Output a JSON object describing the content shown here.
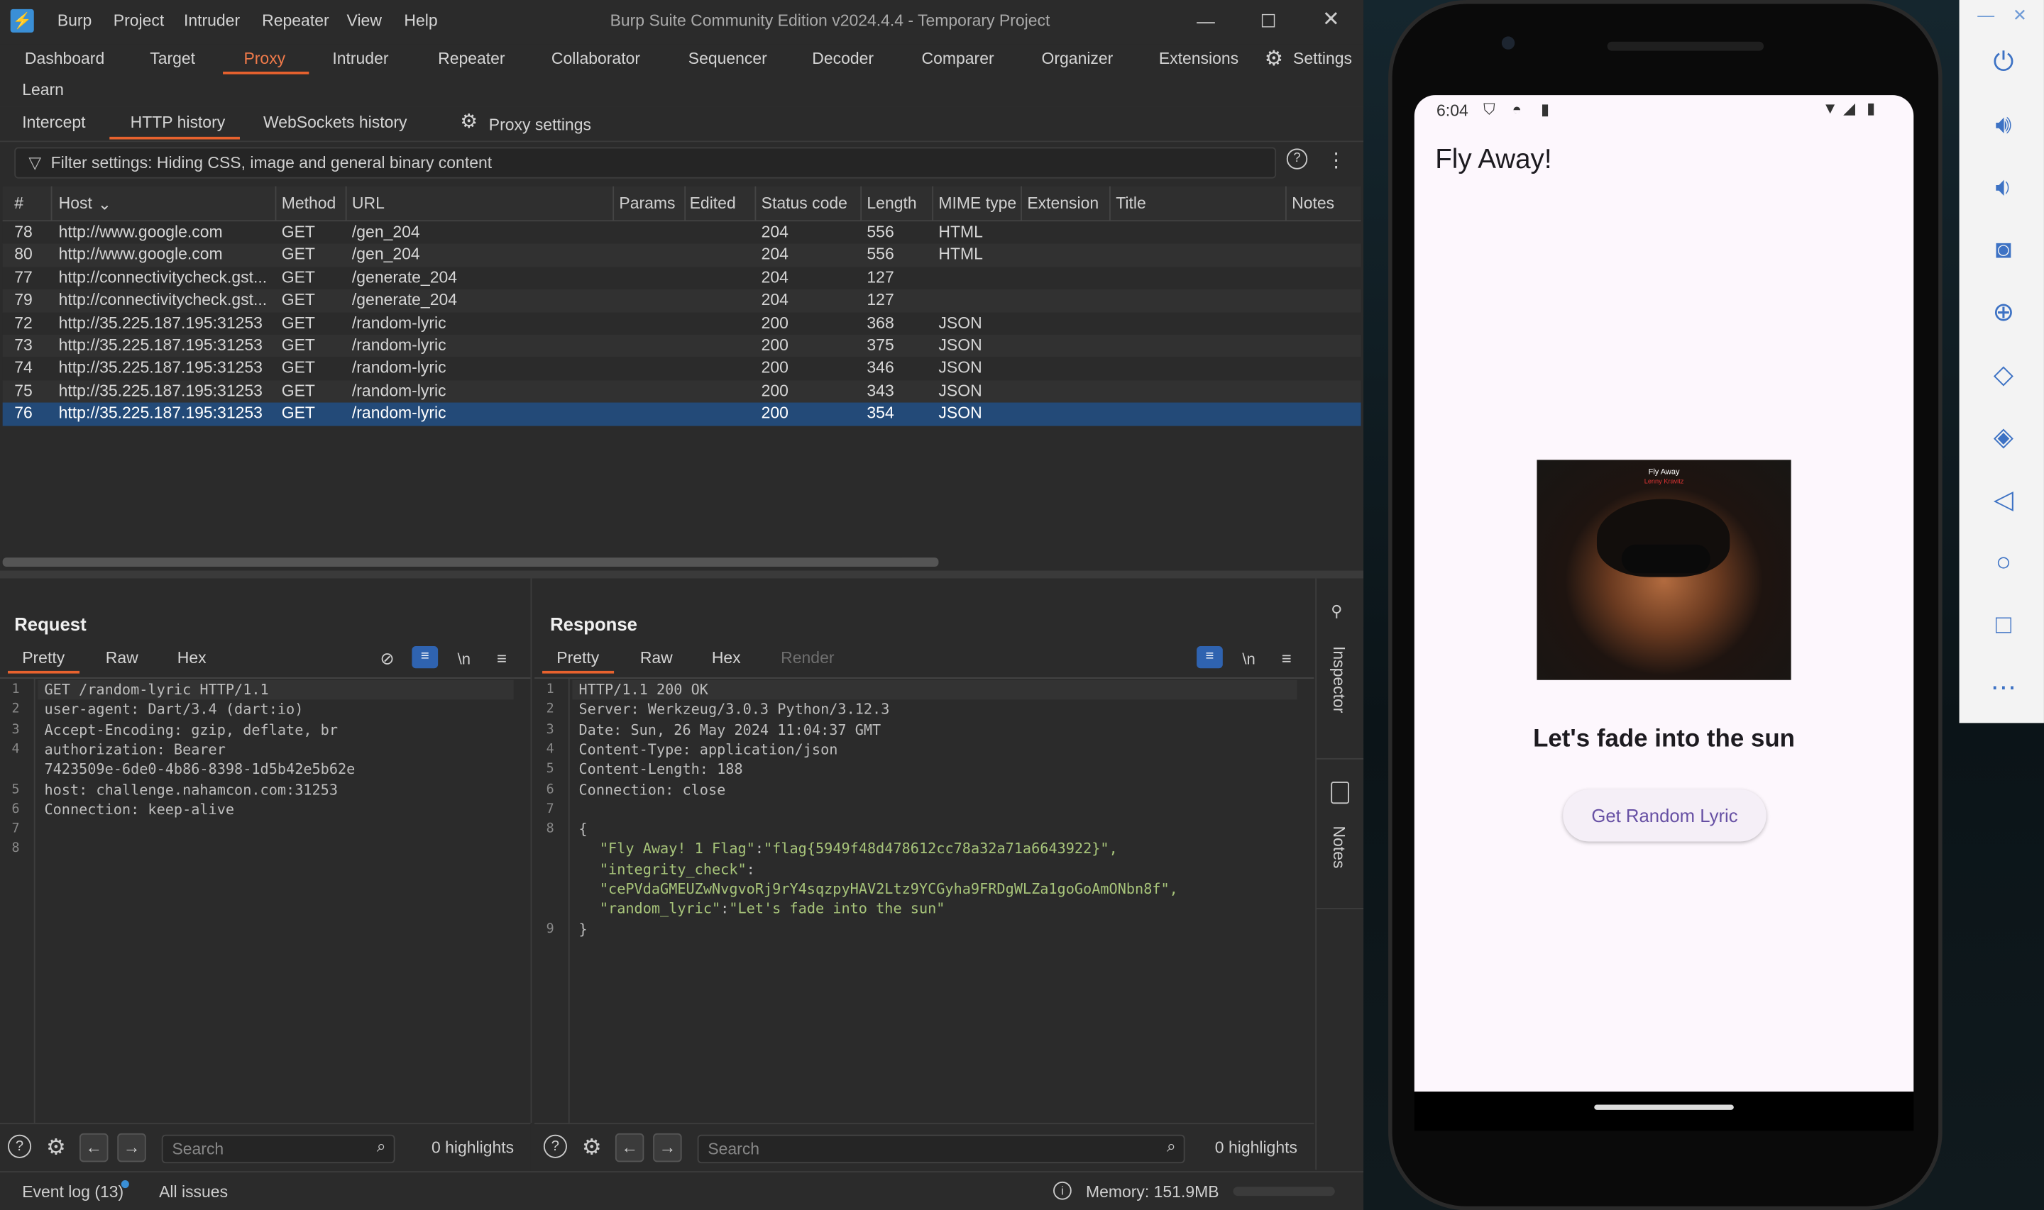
{
  "burp": {
    "menu": [
      "Burp",
      "Project",
      "Intruder",
      "Repeater",
      "View",
      "Help"
    ],
    "window_title": "Burp Suite Community Edition v2024.4.4 - Temporary Project",
    "main_tabs": [
      "Dashboard",
      "Target",
      "Proxy",
      "Intruder",
      "Repeater",
      "Collaborator",
      "Sequencer",
      "Decoder",
      "Comparer",
      "Organizer",
      "Extensions"
    ],
    "settings_label": "Settings",
    "learn_label": "Learn",
    "active_main_tab": "Proxy",
    "sub_tabs": [
      "Intercept",
      "HTTP history",
      "WebSockets history"
    ],
    "active_sub_tab": "HTTP history",
    "proxy_settings_label": "Proxy settings",
    "filter_text": "Filter settings: Hiding CSS, image and general binary content",
    "columns": [
      "#",
      "Host",
      "Method",
      "URL",
      "Params",
      "Edited",
      "Status code",
      "Length",
      "MIME type",
      "Extension",
      "Title",
      "Notes"
    ],
    "rows": [
      {
        "num": "78",
        "host": "http://www.google.com",
        "method": "GET",
        "url": "/gen_204",
        "status": "204",
        "length": "556",
        "mime": "HTML"
      },
      {
        "num": "80",
        "host": "http://www.google.com",
        "method": "GET",
        "url": "/gen_204",
        "status": "204",
        "length": "556",
        "mime": "HTML"
      },
      {
        "num": "77",
        "host": "http://connectivitycheck.gst...",
        "method": "GET",
        "url": "/generate_204",
        "status": "204",
        "length": "127",
        "mime": ""
      },
      {
        "num": "79",
        "host": "http://connectivitycheck.gst...",
        "method": "GET",
        "url": "/generate_204",
        "status": "204",
        "length": "127",
        "mime": ""
      },
      {
        "num": "72",
        "host": "http://35.225.187.195:31253",
        "method": "GET",
        "url": "/random-lyric",
        "status": "200",
        "length": "368",
        "mime": "JSON"
      },
      {
        "num": "73",
        "host": "http://35.225.187.195:31253",
        "method": "GET",
        "url": "/random-lyric",
        "status": "200",
        "length": "375",
        "mime": "JSON"
      },
      {
        "num": "74",
        "host": "http://35.225.187.195:31253",
        "method": "GET",
        "url": "/random-lyric",
        "status": "200",
        "length": "346",
        "mime": "JSON"
      },
      {
        "num": "75",
        "host": "http://35.225.187.195:31253",
        "method": "GET",
        "url": "/random-lyric",
        "status": "200",
        "length": "343",
        "mime": "JSON"
      },
      {
        "num": "76",
        "host": "http://35.225.187.195:31253",
        "method": "GET",
        "url": "/random-lyric",
        "status": "200",
        "length": "354",
        "mime": "JSON",
        "selected": true
      }
    ],
    "request": {
      "title": "Request",
      "tabs": [
        "Pretty",
        "Raw",
        "Hex"
      ],
      "line_numbers": [
        "1",
        "2",
        "3",
        "4",
        "",
        "5",
        "6",
        "7",
        "8"
      ],
      "lines": [
        "GET /random-lyric HTTP/1.1",
        "user-agent: Dart/3.4 (dart:io)",
        "Accept-Encoding: gzip, deflate, br",
        "authorization: Bearer",
        "7423509e-6de0-4b86-8398-1d5b42e5b62e",
        "host: challenge.nahamcon.com:31253",
        "Connection: keep-alive",
        "",
        ""
      ],
      "search_placeholder": "Search",
      "highlights": "0 highlights",
      "newline_label": "\\n"
    },
    "response": {
      "title": "Response",
      "tabs": [
        "Pretty",
        "Raw",
        "Hex",
        "Render"
      ],
      "line_numbers": [
        "1",
        "2",
        "3",
        "4",
        "5",
        "6",
        "7",
        "8",
        "",
        "",
        "",
        "",
        "9"
      ],
      "header_lines": [
        "HTTP/1.1 200 OK",
        "Server: Werkzeug/3.0.3 Python/3.12.3",
        "Date: Sun, 26 May 2024 11:04:37 GMT",
        "Content-Type: application/json",
        "Content-Length: 188",
        "Connection: close",
        ""
      ],
      "json_open": "{",
      "json_lines": [
        {
          "key": "\"Fly Away! 1 Flag\"",
          "value": "\"flag{5949f48d478612cc78a32a71a6643922}\","
        },
        {
          "key": "\"integrity_check\"",
          "value": ""
        },
        {
          "key": "",
          "value": "\"cePVdaGMEUZwNvgvoRj9rY4sqzpyHAV2Ltz9YCGyha9FRDgWLZa1goGoAmONbn8f\","
        },
        {
          "key": "\"random_lyric\"",
          "value": "\"Let's fade into the sun\""
        }
      ],
      "json_close": "}",
      "search_placeholder": "Search",
      "highlights": "0 highlights",
      "newline_label": "\\n"
    },
    "side_tabs": [
      "Inspector",
      "Notes"
    ],
    "status": {
      "event_log": "Event log (13)",
      "all_issues": "All issues",
      "memory": "Memory: 151.9MB"
    }
  },
  "phone": {
    "time": "6:04",
    "app_title": "Fly Away!",
    "album_title": "Fly Away",
    "album_artist": "Lenny Kravitz",
    "lyric": "Let's fade into the sun",
    "button_label": "Get Random Lyric"
  },
  "emulator_toolbar": [
    "power-icon",
    "volume-up-icon",
    "volume-down-icon",
    "camera-icon",
    "zoom-icon",
    "rotate-left-icon",
    "rotate-right-icon",
    "back-icon",
    "home-icon",
    "overview-icon",
    "more-icon"
  ],
  "colors": {
    "accent": "#e8622e",
    "selection": "#234a78",
    "json_string": "#a7c47a",
    "button_text": "#6750a4"
  }
}
